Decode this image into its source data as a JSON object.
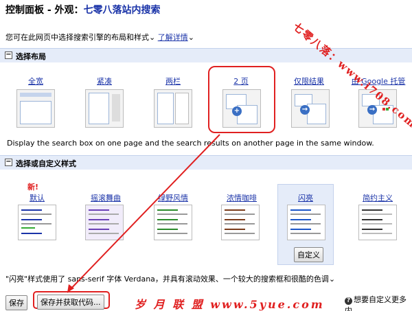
{
  "header": {
    "title_prefix": "控制面板 - 外观：",
    "title_site": "七零八落站内搜索"
  },
  "intro": {
    "text": "您可在此网页中选择搜索引擎的布局和样式",
    "link": "了解详情"
  },
  "layout_section": {
    "toggle": "⊟",
    "heading": "选择布局",
    "options": [
      {
        "label": "全宽"
      },
      {
        "label": "紧凑"
      },
      {
        "label": "两栏"
      },
      {
        "label": "2 页"
      },
      {
        "label": "仅限结果"
      },
      {
        "label": "由 Google 托管"
      }
    ],
    "selected": "2 页",
    "description": "Display the search box on one page and the search results on another page in the same window."
  },
  "style_section": {
    "toggle": "⊟",
    "heading": "选择或自定义样式",
    "new_badge": "新!",
    "options": [
      {
        "label": "默认"
      },
      {
        "label": "摇滚舞曲"
      },
      {
        "label": "绿野风情"
      },
      {
        "label": "浓情咖啡"
      },
      {
        "label": "闪亮"
      },
      {
        "label": "简约主义"
      }
    ],
    "selected": "闪亮",
    "customize_button": "自定义",
    "note": "\"闪亮\"样式使用了 sans-serif 字体 Verdana，并具有滚动效果、一个较大的搜索框和很酷的色调"
  },
  "footer": {
    "save_button": "保存",
    "save_get_code_button": "保存并获取代码...",
    "help_icon": "?",
    "help_text": "想要自定义更多内"
  },
  "watermarks": {
    "right": "七零八落：www.i708.com",
    "bottom": "岁 月 联 盟  www.5yue.com"
  },
  "colors": {
    "accent": "#1a33a8",
    "highlight_red": "#e02020",
    "section_bg": "#e5ecf9"
  }
}
